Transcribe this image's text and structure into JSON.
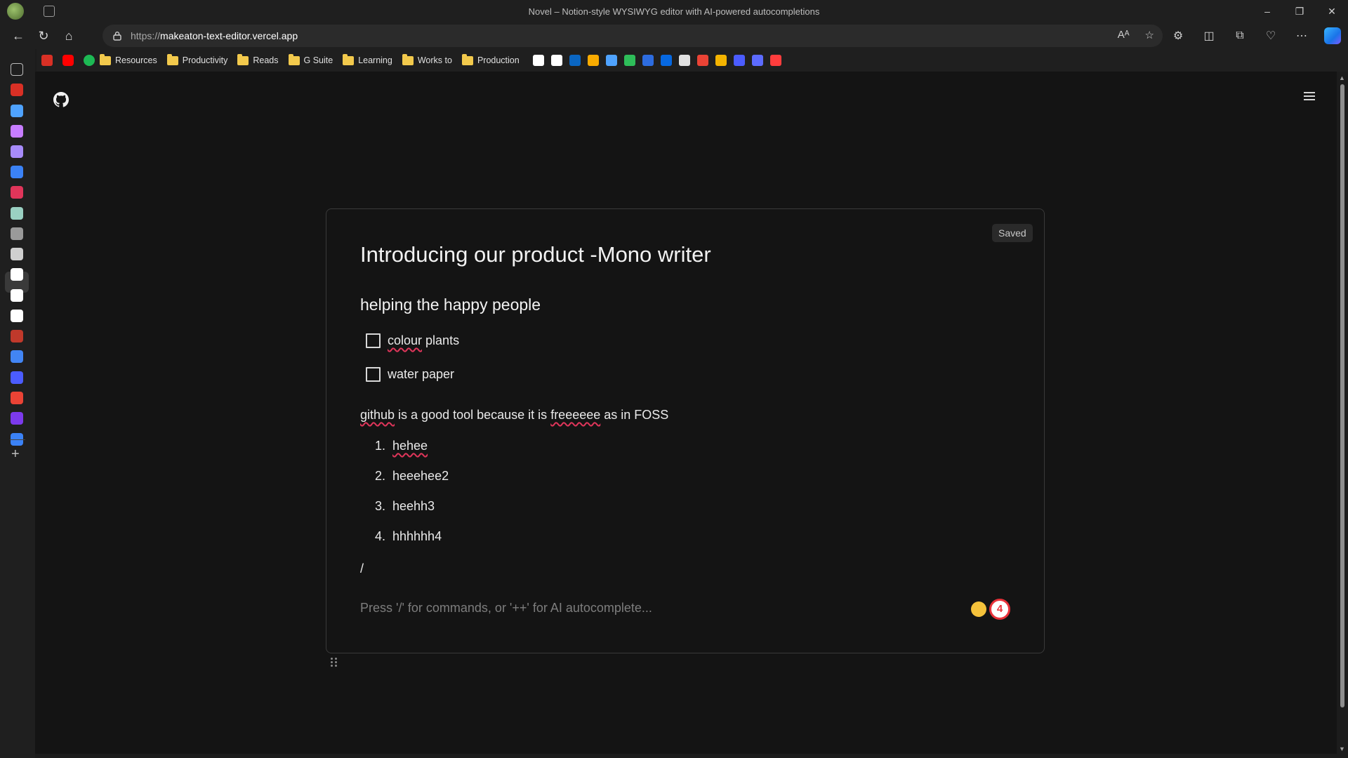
{
  "window": {
    "title": "Novel – Notion-style WYSIWYG editor with AI-powered autocompletions",
    "controls": [
      "–",
      "❐",
      "✕"
    ]
  },
  "toolbar": {
    "url_protocol": "https://",
    "url_host": "makeaton-text-editor.vercel.app"
  },
  "bookmarks": {
    "folders": [
      "Resources",
      "Productivity",
      "Reads",
      "G Suite",
      "Learning",
      "Works to",
      "Production"
    ],
    "icon_colors": [
      "#d93025",
      "#ff0000",
      "#1db954"
    ],
    "trailing_icon_colors": [
      "#ffffff",
      "#ffffff",
      "#0a66c2",
      "#f9ab00",
      "#4fa3ff",
      "#2ebd59",
      "#2d6cdf",
      "#0668e1",
      "#e0e0e0",
      "#ea4335",
      "#f4b400",
      "#4b5cff",
      "#5c6bff",
      "#ff3d3d"
    ]
  },
  "editor": {
    "status": "Saved",
    "heading": "Introducing our product -Mono writer",
    "subheading": "helping the happy people",
    "tasks": [
      {
        "word1": "colour",
        "rest": " plants",
        "checked": false
      },
      {
        "word1": "water paper",
        "rest": "",
        "checked": false
      }
    ],
    "paragraph": {
      "p1": "github",
      "p2": " is a good tool because it is ",
      "p3": "freeeeee",
      "p4": " as in FOSS"
    },
    "list": [
      {
        "num": "1.",
        "text": "hehee"
      },
      {
        "num": "2.",
        "text": "heeehee2"
      },
      {
        "num": "3.",
        "text": "heehh3"
      },
      {
        "num": "4.",
        "text": "hhhhhh4"
      }
    ],
    "slash": "/",
    "placeholder": "Press '/' for commands, or '++' for AI autocomplete...",
    "badge_count": "4"
  }
}
